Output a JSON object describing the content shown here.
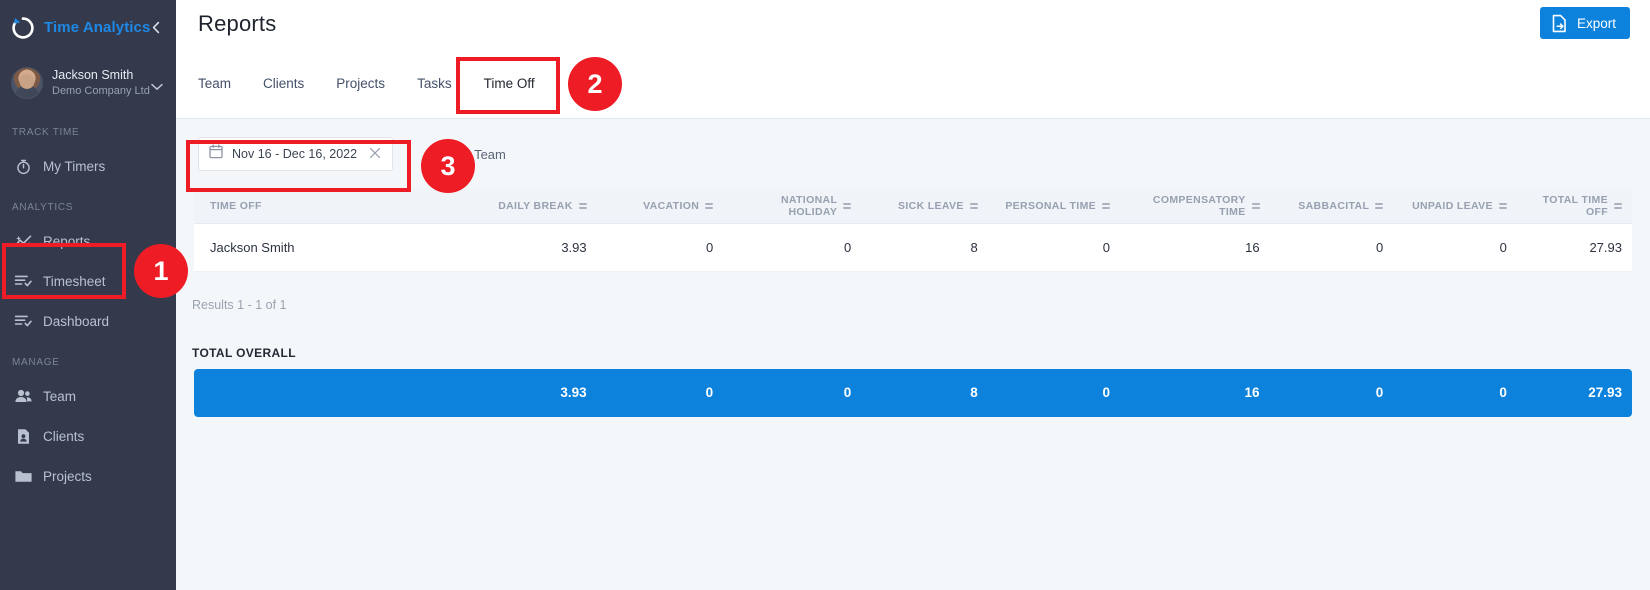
{
  "sidebar": {
    "brand": "Time Analytics",
    "collapse_icon": "chevron-left-icon",
    "user": {
      "name": "Jackson Smith",
      "company": "Demo Company Ltd",
      "caret_icon": "chevron-down-icon"
    },
    "sections": [
      {
        "label": "TRACK TIME",
        "items": [
          {
            "label": "My Timers",
            "icon": "stopwatch-icon"
          }
        ]
      },
      {
        "label": "ANALYTICS",
        "items": [
          {
            "label": "Reports",
            "icon": "analytics-chart-icon"
          },
          {
            "label": "Timesheet",
            "icon": "timesheet-check-icon"
          },
          {
            "label": "Dashboard",
            "icon": "dashboard-lines-icon"
          }
        ]
      },
      {
        "label": "MANAGE",
        "items": [
          {
            "label": "Team",
            "icon": "people-icon"
          },
          {
            "label": "Clients",
            "icon": "client-card-icon"
          },
          {
            "label": "Projects",
            "icon": "folder-icon"
          }
        ]
      }
    ]
  },
  "header": {
    "title": "Reports",
    "export_label": "Export",
    "export_icon": "file-export-icon",
    "export_color": "#0c82dd"
  },
  "tabs": [
    {
      "label": "Team",
      "active": false
    },
    {
      "label": "Clients",
      "active": false
    },
    {
      "label": "Projects",
      "active": false
    },
    {
      "label": "Tasks",
      "active": false
    },
    {
      "label": "Time Off",
      "active": true
    }
  ],
  "filters": {
    "date_range": "Nov 16 - Dec 16, 2022",
    "calendar_icon": "calendar-icon",
    "clear_icon": "close-icon",
    "team_label": "Team",
    "team_icon": "people-icon"
  },
  "table": {
    "columns": [
      "TIME OFF",
      "DAILY BREAK",
      "VACATION",
      "NATIONAL HOLIDAY",
      "SICK LEAVE",
      "PERSONAL TIME",
      "COMPENSATORY TIME",
      "SABBACITAL",
      "UNPAID LEAVE",
      "TOTAL TIME OFF"
    ],
    "rows": [
      {
        "name": "Jackson Smith",
        "values": [
          "3.93",
          "0",
          "0",
          "8",
          "0",
          "16",
          "0",
          "0",
          "27.93"
        ]
      }
    ],
    "results_text": "Results 1 - 1 of 1"
  },
  "totals": {
    "label": "TOTAL OVERALL",
    "values": [
      "3.93",
      "0",
      "0",
      "8",
      "0",
      "16",
      "0",
      "0",
      "27.93"
    ],
    "bar_color": "#0c82dd"
  },
  "annotations": [
    {
      "number": "1",
      "target": "sidebar-item-reports"
    },
    {
      "number": "2",
      "target": "tab-time-off"
    },
    {
      "number": "3",
      "target": "date-range-filter"
    }
  ]
}
